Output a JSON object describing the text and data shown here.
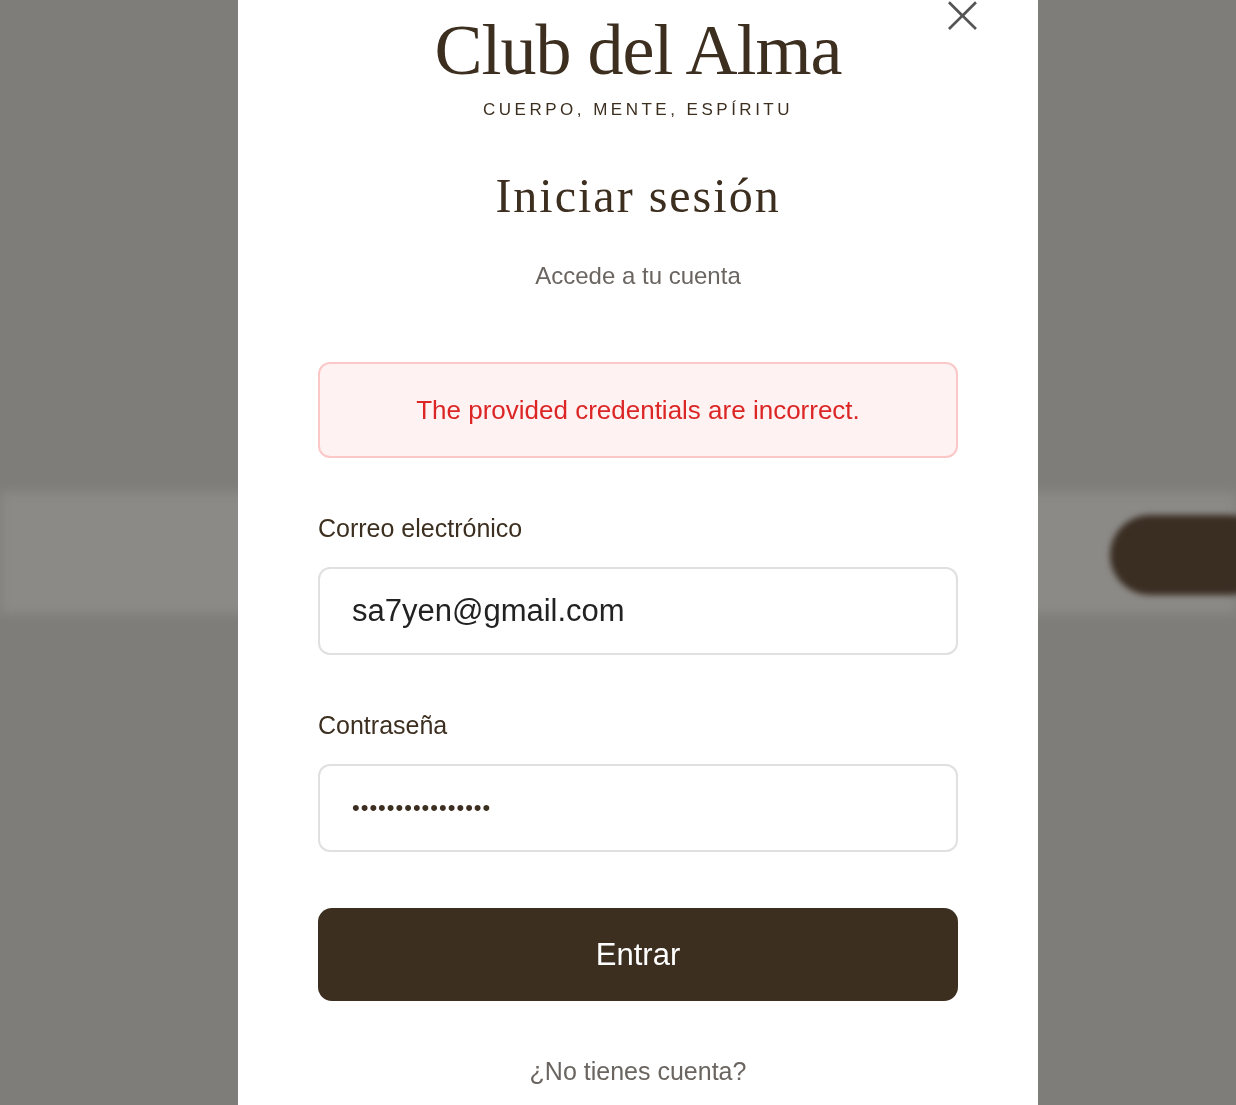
{
  "brand": {
    "name": "Club del Alma",
    "tagline": "CUERPO, MENTE, ESPÍRITU"
  },
  "close": {
    "symbol": "×"
  },
  "title": "Iniciar sesión",
  "subtitle": "Accede a tu cuenta",
  "error": "The provided credentials are incorrect.",
  "fields": [
    {
      "label": "Correo electrónico",
      "value": "sa7yen@gmail.com",
      "kind": "text"
    },
    {
      "label": "Contraseña",
      "value": "••••••••••••••••",
      "kind": "password"
    }
  ],
  "submit": "Entrar",
  "footer": "¿No tienes cuenta?"
}
